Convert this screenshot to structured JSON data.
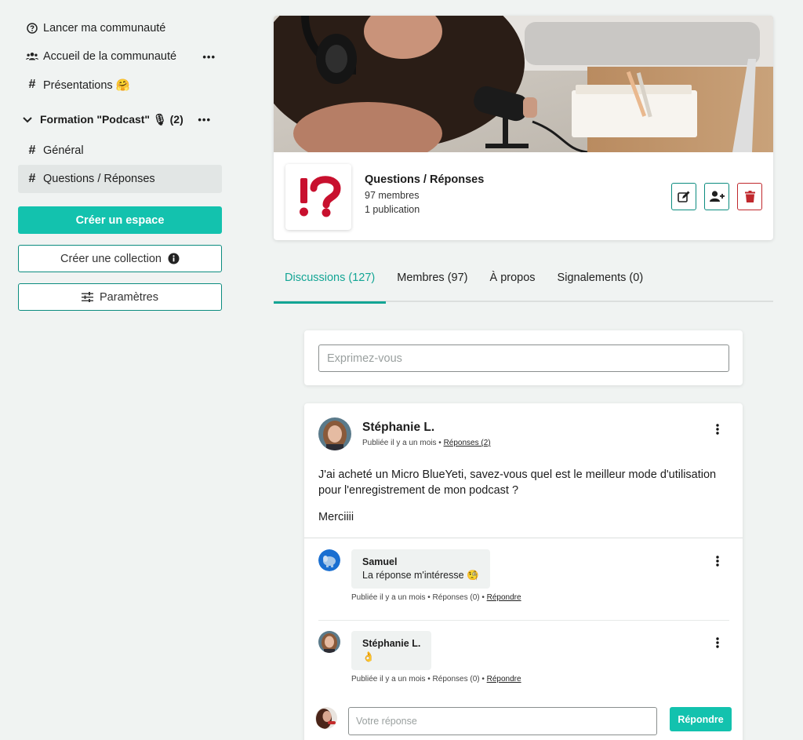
{
  "sidebar": {
    "items_top": [
      {
        "icon": "help-circle-icon",
        "label": "Lancer ma communauté"
      },
      {
        "icon": "users-icon",
        "label": "Accueil de la communauté",
        "more": "•••"
      },
      {
        "icon": "hash-icon",
        "label": "Présentations 🤗"
      }
    ],
    "group": {
      "label": "Formation \"Podcast\" 🎙 (2)",
      "more": "•••"
    },
    "group_items": [
      {
        "icon": "hash-icon",
        "label": "Général"
      },
      {
        "icon": "hash-icon",
        "label": "Questions / Réponses",
        "active": true
      }
    ],
    "create_space_label": "Créer un espace",
    "create_collection_label": "Créer une collection",
    "settings_label": "Paramètres"
  },
  "space": {
    "title": "Questions / Réponses",
    "members": "97 membres",
    "publications": "1 publication",
    "logo_text": "!?",
    "actions": [
      "edit-icon",
      "add-member-icon",
      "trash-icon"
    ]
  },
  "tabs": [
    {
      "label": "Discussions (127)",
      "active": true
    },
    {
      "label": "Membres (97)"
    },
    {
      "label": "À propos"
    },
    {
      "label": "Signalements (0)"
    }
  ],
  "composer": {
    "placeholder": "Exprimez-vous"
  },
  "post": {
    "author": "Stéphanie L.",
    "published": "Publiée il y a un mois • ",
    "replies_link": "Réponses (2)",
    "body": [
      "J'ai acheté un Micro BlueYeti, savez-vous quel est le meilleur mode d'utilisation pour l'enregistrement de mon podcast ?",
      "Merciiii"
    ],
    "replies": [
      {
        "author": "Samuel",
        "text": "La réponse m'intéresse 🧐",
        "meta": "Publiée il y a un mois • Réponses (0) • ",
        "reply_link": "Répondre"
      },
      {
        "author": "Stéphanie L.",
        "text": "👌",
        "meta": "Publiée il y a un mois • Réponses (0) • ",
        "reply_link": "Répondre"
      }
    ],
    "reply_placeholder": "Votre réponse",
    "reply_button": "Répondre"
  },
  "colors": {
    "accent": "#13c2ae",
    "accent_dark": "#0b8c7f",
    "danger": "#c0282d",
    "logo_red": "#c8102e",
    "background": "#f0f3f2"
  }
}
